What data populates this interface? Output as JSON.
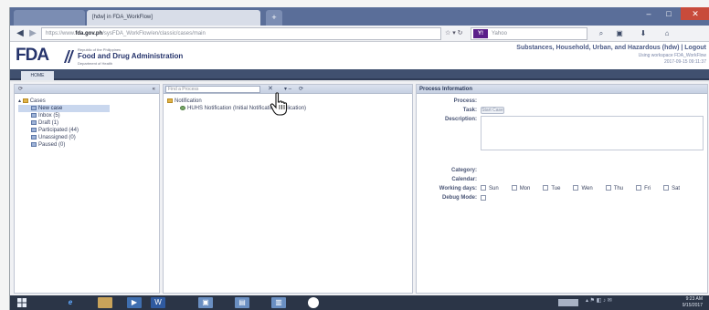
{
  "browser": {
    "tab_inactive": "",
    "tab_active": "[hdw] in FDA_WorkFlow]",
    "tab_new": "+",
    "url_prefix": "https://www.",
    "url_host": "fda.gov.ph",
    "url_path": "/sysFDA_WorkFlow/en/classic/cases/main",
    "search_placeholder": "Yahoo",
    "search_engine_mark": "Y!",
    "win_min": "–",
    "win_max": "□",
    "win_close": "✕"
  },
  "header": {
    "logo": "FDA",
    "dept": "Republic of the Philippines",
    "agency": "Food and Drug Administration",
    "dept_sub": "Department of Health",
    "title": "Substances, Household, Urban, and Hazardous (hdw) | Logout",
    "user_line": "Using workspace FDA_WorkFlow",
    "date_line": "2017-09-15 09:11:37"
  },
  "menu": {
    "home": "HOME"
  },
  "left": {
    "root": "Cases",
    "items": [
      {
        "label": "New case"
      },
      {
        "label": "Inbox (5)"
      },
      {
        "label": "Draft (1)"
      },
      {
        "label": "Participated (44)"
      },
      {
        "label": "Unassigned (0)"
      },
      {
        "label": "Paused (0)"
      }
    ]
  },
  "middle": {
    "search_placeholder": "Find a Process",
    "clear": "✕",
    "folder": "Notification",
    "process": "HUHS Notification (Initial Notification Application)"
  },
  "right": {
    "title": "Process Information",
    "labels": {
      "process": "Process:",
      "task": "Task:",
      "description": "Description:",
      "category": "Category:",
      "calendar": "Calendar:",
      "working_days": "Working days:",
      "debug": "Debug Mode:"
    },
    "start_case": "Start Case",
    "days": [
      "Sun",
      "Mon",
      "Tue",
      "Wen",
      "Thu",
      "Fri",
      "Sat"
    ]
  },
  "taskbar": {
    "time": "9:23 AM",
    "date": "9/15/2017"
  }
}
